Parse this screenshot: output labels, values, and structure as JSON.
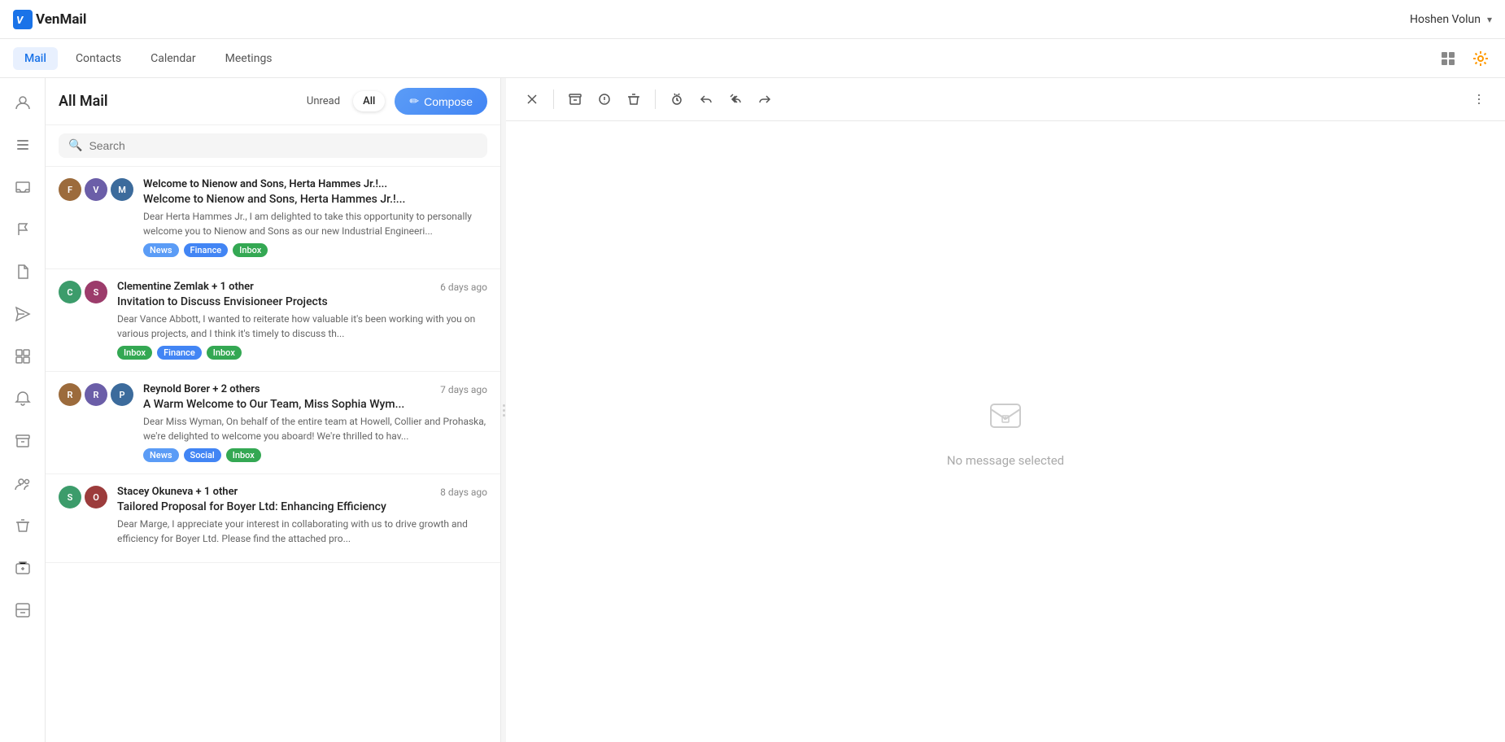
{
  "app": {
    "name": "VenMail",
    "logo_letter": "V"
  },
  "topbar": {
    "user_name": "Hoshen Volun",
    "chevron": "▾"
  },
  "nav": {
    "items": [
      {
        "label": "Mail",
        "active": true
      },
      {
        "label": "Contacts",
        "active": false
      },
      {
        "label": "Calendar",
        "active": false
      },
      {
        "label": "Meetings",
        "active": false
      }
    ]
  },
  "sidebar": {
    "icons": [
      {
        "name": "user-icon",
        "symbol": "👤",
        "active": false
      },
      {
        "name": "list-icon",
        "symbol": "☰",
        "active": false
      },
      {
        "name": "inbox-icon",
        "symbol": "📥",
        "active": false
      },
      {
        "name": "flag-icon",
        "symbol": "🏴",
        "active": false
      },
      {
        "name": "file-icon",
        "symbol": "📄",
        "active": false
      },
      {
        "name": "send-icon",
        "symbol": "➤",
        "active": false
      },
      {
        "name": "grid-icon",
        "symbol": "▦",
        "active": false
      },
      {
        "name": "bell-icon",
        "symbol": "🔔",
        "active": false
      },
      {
        "name": "archive-icon",
        "symbol": "🗄",
        "active": false
      },
      {
        "name": "contacts-icon",
        "symbol": "👥",
        "active": false
      },
      {
        "name": "trash2-icon",
        "symbol": "🗑",
        "active": false
      },
      {
        "name": "delete-icon",
        "symbol": "🗑",
        "active": false
      },
      {
        "name": "drawer-icon",
        "symbol": "🗂",
        "active": false
      }
    ]
  },
  "mail_panel": {
    "title": "All Mail",
    "compose_label": "Compose",
    "filter_tabs": [
      {
        "label": "Unread",
        "active": false
      },
      {
        "label": "All",
        "active": true
      }
    ],
    "search_placeholder": "Search"
  },
  "emails": [
    {
      "id": 1,
      "avatars": [
        {
          "initials": "F",
          "color": "#9c6b3c"
        },
        {
          "initials": "V",
          "color": "#6b5ea8"
        },
        {
          "initials": "M",
          "color": "#3c6b9c"
        }
      ],
      "sender": "Welcome to Nienow and Sons, Herta Hammes Jr.!...",
      "time": "",
      "subject": "Welcome to Nienow and Sons, Herta Hammes Jr.!...",
      "preview": "Dear Herta Hammes Jr., I am delighted to take this opportunity to personally welcome you to Nienow and Sons as our new Industrial Engineeri...",
      "tags": [
        {
          "label": "News",
          "class": "tag-news"
        },
        {
          "label": "Finance",
          "class": "tag-finance"
        },
        {
          "label": "Inbox",
          "class": "tag-inbox"
        }
      ]
    },
    {
      "id": 2,
      "avatars": [
        {
          "initials": "C",
          "color": "#3c9c6b"
        },
        {
          "initials": "S",
          "color": "#9c3c6b"
        }
      ],
      "sender": "Clementine Zemlak + 1 other",
      "time": "6 days ago",
      "subject": "Invitation to Discuss Envisioneer Projects",
      "preview": "Dear Vance Abbott, I wanted to reiterate how valuable it's been working with you on various projects, and I think it's timely to discuss th...",
      "tags": [
        {
          "label": "Inbox",
          "class": "tag-inbox"
        },
        {
          "label": "Finance",
          "class": "tag-finance"
        },
        {
          "label": "Inbox",
          "class": "tag-inbox"
        }
      ]
    },
    {
      "id": 3,
      "avatars": [
        {
          "initials": "R",
          "color": "#9c6b3c"
        },
        {
          "initials": "R",
          "color": "#6b5ea8"
        },
        {
          "initials": "P",
          "color": "#3c6b9c"
        }
      ],
      "sender": "Reynold Borer + 2 others",
      "time": "7 days ago",
      "subject": "A Warm Welcome to Our Team, Miss Sophia Wym...",
      "preview": "Dear Miss Wyman, On behalf of the entire team at Howell, Collier and Prohaska, we're delighted to welcome you aboard! We're thrilled to hav...",
      "tags": [
        {
          "label": "News",
          "class": "tag-news"
        },
        {
          "label": "Social",
          "class": "tag-social"
        },
        {
          "label": "Inbox",
          "class": "tag-inbox"
        }
      ]
    },
    {
      "id": 4,
      "avatars": [
        {
          "initials": "S",
          "color": "#3c9c6b"
        },
        {
          "initials": "O",
          "color": "#9c3c3c"
        }
      ],
      "sender": "Stacey Okuneva + 1 other",
      "time": "8 days ago",
      "subject": "Tailored Proposal for Boyer Ltd: Enhancing Efficiency",
      "preview": "Dear Marge, I appreciate your interest in collaborating with us to drive growth and efficiency for Boyer Ltd. Please find the attached pro...",
      "tags": []
    }
  ],
  "right_panel": {
    "empty_text": "No message selected",
    "toolbar": {
      "close": "×",
      "archive": "📦",
      "spam": "⚠",
      "delete": "🗑",
      "snooze": "⏰",
      "reply": "↩",
      "reply_all": "↩↩",
      "forward": "→",
      "more": "⋮"
    }
  }
}
